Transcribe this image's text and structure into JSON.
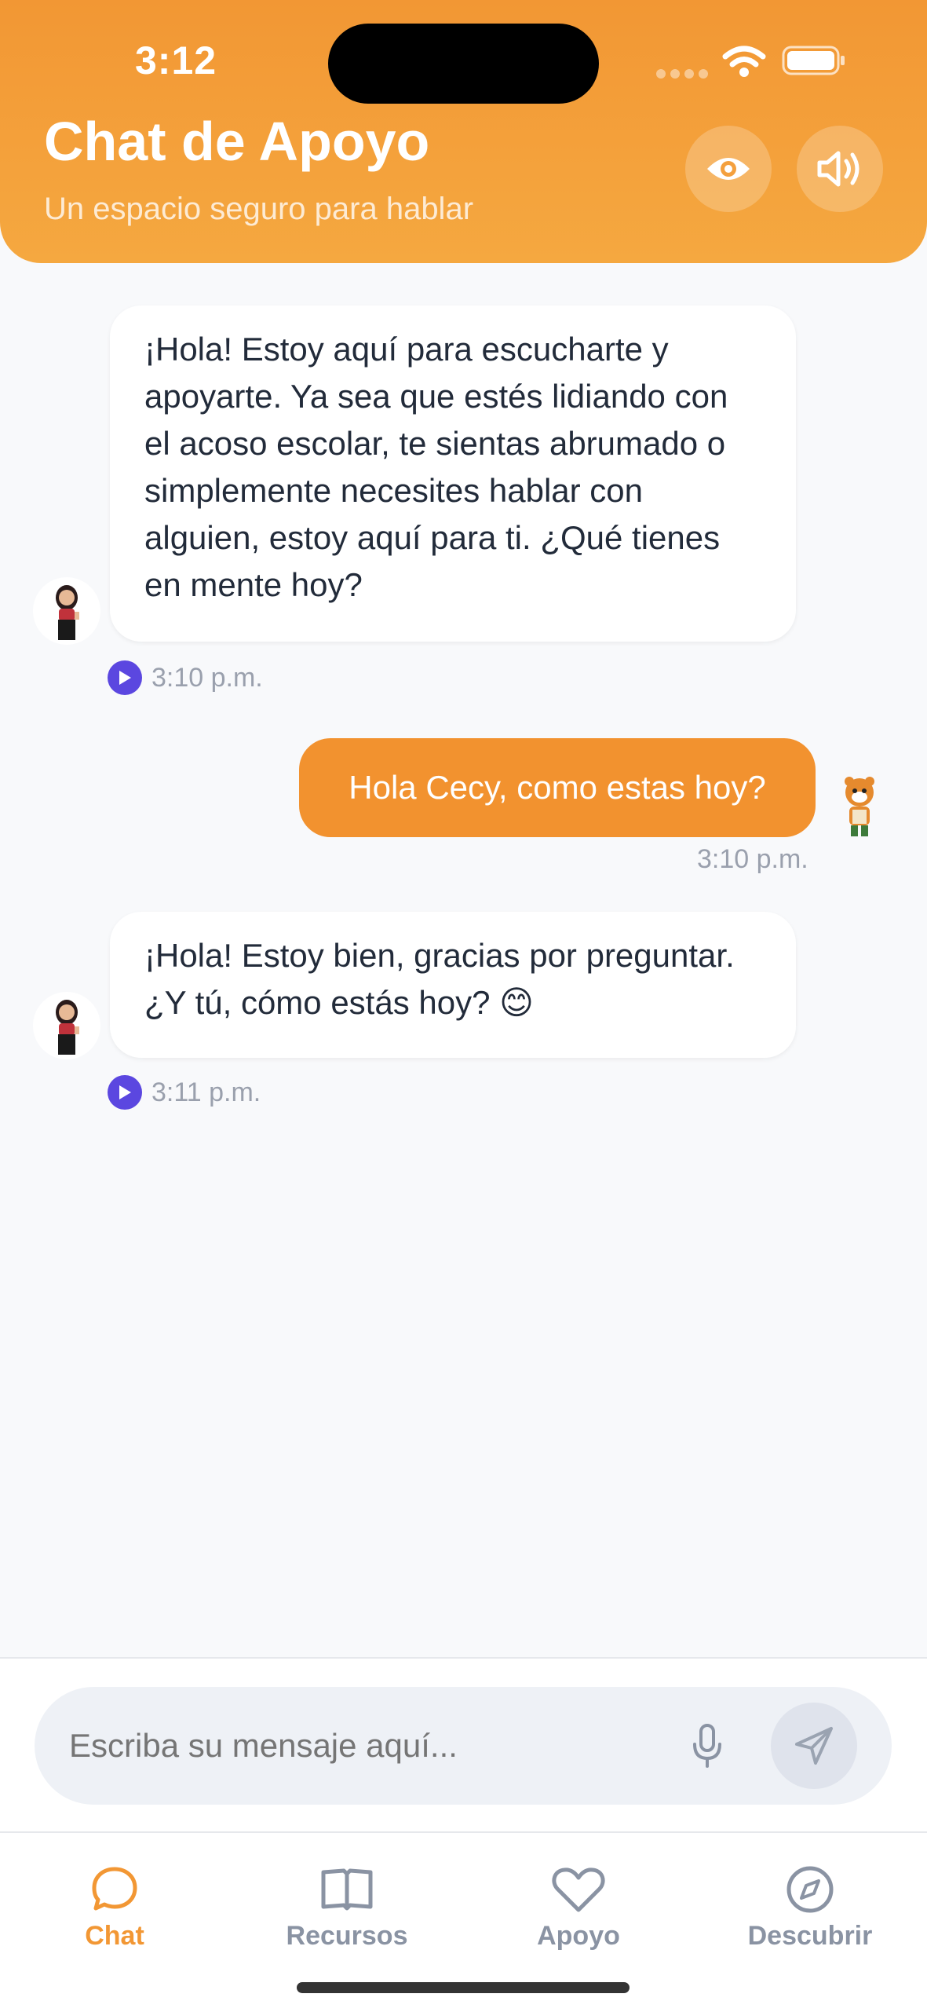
{
  "status_bar": {
    "time": "3:12"
  },
  "header": {
    "title": "Chat de Apoyo",
    "subtitle": "Un espacio seguro para hablar",
    "accent_color": "#f29734",
    "buttons": [
      {
        "icon": "eye-icon"
      },
      {
        "icon": "speaker-icon"
      }
    ]
  },
  "messages": [
    {
      "sender": "bot",
      "text": "¡Hola! Estoy aquí para escucharte y apoyarte. Ya sea que estés lidiando con el acoso escolar, te sientas abrumado o simplemente necesites hablar con alguien, estoy aquí para ti. ¿Qué tienes en mente hoy?",
      "time": "3:10 p.m."
    },
    {
      "sender": "user",
      "text": "Hola Cecy, como estas hoy?",
      "time": "3:10 p.m."
    },
    {
      "sender": "bot",
      "text": "¡Hola! Estoy bien, gracias por preguntar. ¿Y tú, cómo estás hoy? 😊",
      "time": "3:11 p.m."
    }
  ],
  "composer": {
    "placeholder": "Escriba su mensaje aquí...",
    "value": ""
  },
  "nav": {
    "items": [
      {
        "label": "Chat",
        "icon": "chat-bubble-icon",
        "active": true
      },
      {
        "label": "Recursos",
        "icon": "book-icon",
        "active": false
      },
      {
        "label": "Apoyo",
        "icon": "heart-icon",
        "active": false
      },
      {
        "label": "Descubrir",
        "icon": "compass-icon",
        "active": false
      }
    ],
    "active_color": "#f29734",
    "inactive_color": "#8a93a3"
  }
}
